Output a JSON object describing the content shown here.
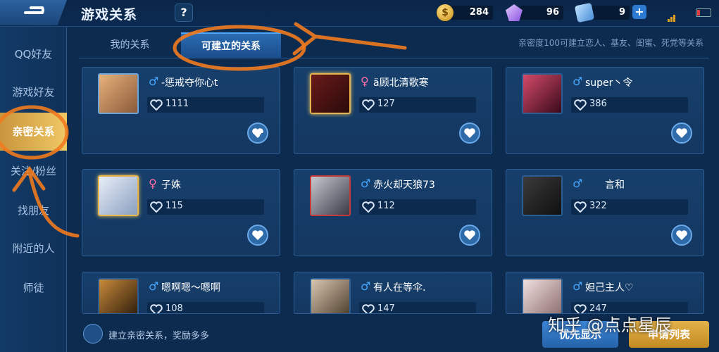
{
  "header": {
    "title": "游戏关系",
    "help_label": "?",
    "gold": "284",
    "gems": "96",
    "tickets": "9",
    "plus_label": "+"
  },
  "sidebar": {
    "items": [
      {
        "label": "QQ好友",
        "active": false
      },
      {
        "label": "游戏好友",
        "active": false
      },
      {
        "label": "亲密关系",
        "active": true
      },
      {
        "label": "关注/粉丝",
        "active": false
      },
      {
        "label": "找朋友",
        "active": false
      },
      {
        "label": "附近的人",
        "active": false
      },
      {
        "label": "师徒",
        "active": false
      }
    ]
  },
  "tabs": [
    {
      "label": "我的关系",
      "active": false
    },
    {
      "label": "可建立的关系",
      "active": true
    }
  ],
  "top_hint": "亲密度100可建立恋人、基友、闺蜜、死党等关系",
  "cards": [
    {
      "gender": "♂",
      "name": "-惩戒夺你心t",
      "intimacy": "1111"
    },
    {
      "gender": "♀",
      "name": "ä顾北清歌寒",
      "intimacy": "127"
    },
    {
      "gender": "♂",
      "name": "super丶令",
      "intimacy": "386"
    },
    {
      "gender": "♀",
      "name": "子姝",
      "intimacy": "115"
    },
    {
      "gender": "♂",
      "name": "赤火却天狼73",
      "intimacy": "112"
    },
    {
      "gender": "♂",
      "name": "言和",
      "intimacy": "322"
    },
    {
      "gender": "♂",
      "name": "嗯啊嗯～嗯啊",
      "intimacy": "108"
    },
    {
      "gender": "♂",
      "name": "有人在等伞.",
      "intimacy": "147"
    },
    {
      "gender": "♂",
      "name": "妲己主人♡",
      "intimacy": "247"
    }
  ],
  "bottom": {
    "hint": "建立亲密关系，奖励多多",
    "priority_button": "优先显示",
    "apply_button": "申请列表"
  },
  "watermark": "知乎 @点点星辰",
  "colors": {
    "accent_gold": "#e3b24a",
    "accent_blue": "#2d7bd1",
    "male": "#47a8ff",
    "female": "#ff6fa8",
    "annotation": "#f07a1e"
  }
}
